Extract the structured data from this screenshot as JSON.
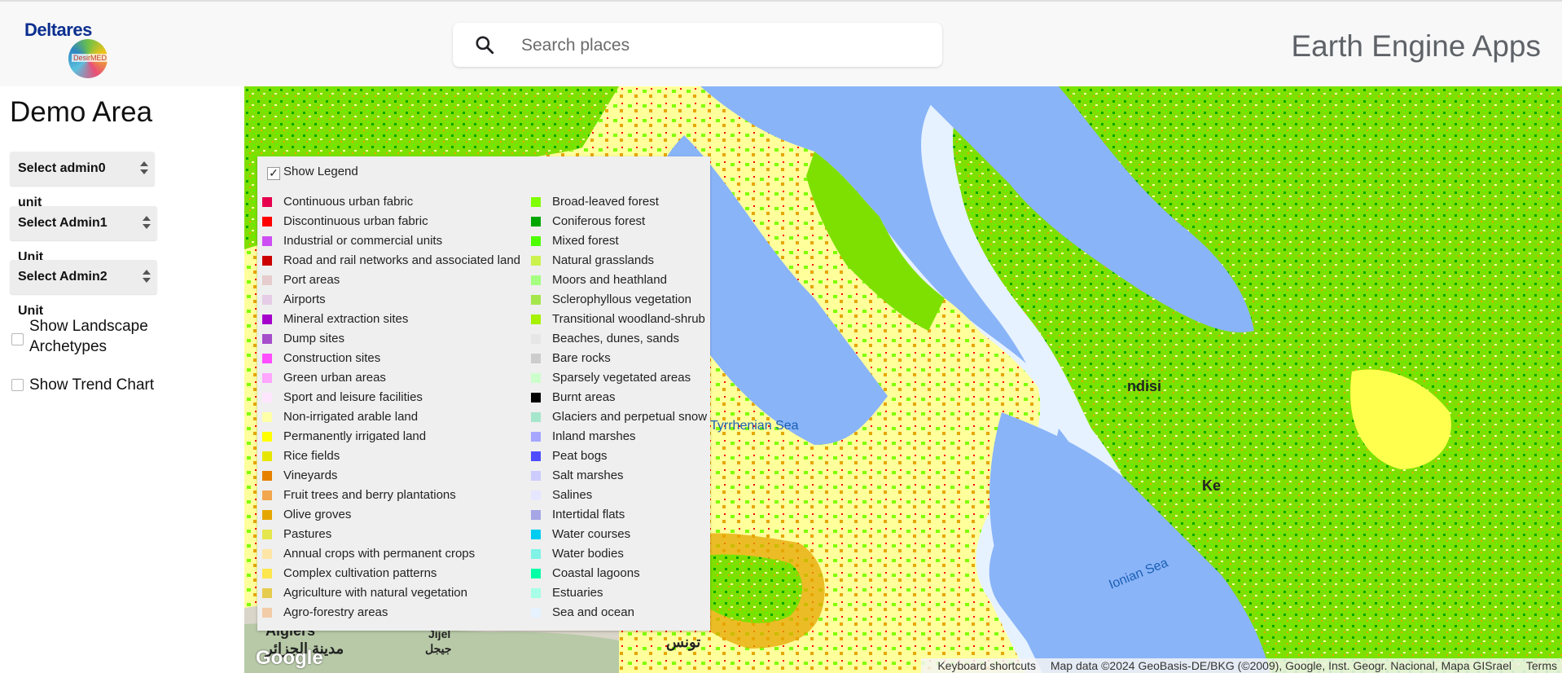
{
  "header": {
    "logo_text": "Deltares",
    "logo_subtext": "DesirMED",
    "search_placeholder": "Search places",
    "app_title": "Earth Engine Apps"
  },
  "sidebar": {
    "title": "Demo Area",
    "select_admin0": "Select admin0 unit",
    "select_admin1": "Select Admin1 Unit",
    "select_admin2": "Select Admin2 Unit",
    "show_archetypes": "Show Landscape Archetypes",
    "show_trend": "Show Trend Chart"
  },
  "map": {
    "labels": {
      "tyrrhenian": "Tyrrhenian Sea",
      "ionian": "Ionian Sea",
      "algiers": "Algiers",
      "algiers_ar": "مدينة الجزائر",
      "jijel": "Jijel",
      "jijel_ar": "جيجل",
      "tunis_ar": "تونس",
      "kerkyra_partial": "Ke",
      "brindisi_partial": "ndisi"
    },
    "google_logo": "Google",
    "attribution": {
      "shortcuts": "Keyboard shortcuts",
      "data": "Map data ©2024 GeoBasis-DE/BKG (©2009), Google, Inst. Geogr. Nacional, Mapa GISrael",
      "terms": "Terms"
    }
  },
  "legend": {
    "toggle_label": "Show Legend",
    "left_items": [
      {
        "label": "Continuous urban fabric",
        "color": "#e6004d"
      },
      {
        "label": "Discontinuous urban fabric",
        "color": "#ff0000"
      },
      {
        "label": "Industrial or commercial units",
        "color": "#cc4df2"
      },
      {
        "label": "Road and rail networks and associated land",
        "color": "#cc0000"
      },
      {
        "label": "Port areas",
        "color": "#e6cccc"
      },
      {
        "label": "Airports",
        "color": "#e6cce6"
      },
      {
        "label": "Mineral extraction sites",
        "color": "#a600cc"
      },
      {
        "label": "Dump sites",
        "color": "#a64dcc"
      },
      {
        "label": "Construction sites",
        "color": "#ff4dff"
      },
      {
        "label": "Green urban areas",
        "color": "#ffa6ff"
      },
      {
        "label": "Sport and leisure facilities",
        "color": "#ffe6ff"
      },
      {
        "label": "Non-irrigated arable land",
        "color": "#ffffa8"
      },
      {
        "label": "Permanently irrigated land",
        "color": "#ffff00"
      },
      {
        "label": "Rice fields",
        "color": "#e6e600"
      },
      {
        "label": "Vineyards",
        "color": "#e68000"
      },
      {
        "label": "Fruit trees and berry plantations",
        "color": "#f2a64d"
      },
      {
        "label": "Olive groves",
        "color": "#e6a600"
      },
      {
        "label": "Pastures",
        "color": "#e6e64d"
      },
      {
        "label": "Annual crops with permanent crops",
        "color": "#ffe6a6"
      },
      {
        "label": "Complex cultivation patterns",
        "color": "#ffe64d"
      },
      {
        "label": "Agriculture with natural vegetation",
        "color": "#e6cc4d"
      },
      {
        "label": "Agro-forestry areas",
        "color": "#f2cca6"
      }
    ],
    "right_items": [
      {
        "label": "Broad-leaved forest",
        "color": "#80ff00"
      },
      {
        "label": "Coniferous forest",
        "color": "#00a600"
      },
      {
        "label": "Mixed forest",
        "color": "#4dff00"
      },
      {
        "label": "Natural grasslands",
        "color": "#ccf24d"
      },
      {
        "label": "Moors and heathland",
        "color": "#a6ff80"
      },
      {
        "label": "Sclerophyllous vegetation",
        "color": "#a6e64d"
      },
      {
        "label": "Transitional woodland-shrub",
        "color": "#a6f200"
      },
      {
        "label": "Beaches, dunes, sands",
        "color": "#e6e6e6"
      },
      {
        "label": "Bare rocks",
        "color": "#cccccc"
      },
      {
        "label": "Sparsely vegetated areas",
        "color": "#ccffcc"
      },
      {
        "label": "Burnt areas",
        "color": "#000000"
      },
      {
        "label": "Glaciers and perpetual snow",
        "color": "#a6e6cc"
      },
      {
        "label": "Inland marshes",
        "color": "#a6a6ff"
      },
      {
        "label": "Peat bogs",
        "color": "#4d4dff"
      },
      {
        "label": "Salt marshes",
        "color": "#ccccff"
      },
      {
        "label": "Salines",
        "color": "#e6e6ff"
      },
      {
        "label": "Intertidal flats",
        "color": "#a6a6e6"
      },
      {
        "label": "Water courses",
        "color": "#00ccf2"
      },
      {
        "label": "Water bodies",
        "color": "#80f2e6"
      },
      {
        "label": "Coastal lagoons",
        "color": "#00ffa6"
      },
      {
        "label": "Estuaries",
        "color": "#a6ffe6"
      },
      {
        "label": "Sea and ocean",
        "color": "#e6f2ff"
      }
    ]
  }
}
